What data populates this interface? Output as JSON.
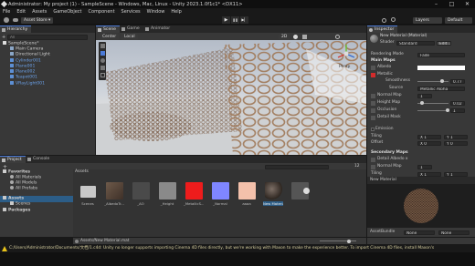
{
  "window": {
    "title": "Administrator: My project (1) - SampleScene - Windows, Mac, Linux - Unity 2023.1.0f1c1* <DX11>",
    "minimize": "–",
    "maximize": "□",
    "close": "✕"
  },
  "menu": [
    "File",
    "Edit",
    "Assets",
    "GameObject",
    "Component",
    "Services",
    "Window",
    "Help"
  ],
  "toolbar": {
    "account": "Asset Store ▾",
    "play": "▶",
    "pause": "❚❚",
    "step": "▶▏",
    "layers": "Layers",
    "layout": "Default"
  },
  "hierarchy": {
    "tab": "Hierarchy",
    "search_placeholder": "All",
    "scene": "SampleScene*",
    "items": [
      "Main Camera",
      "Directional Light",
      "Cylinder001",
      "Plane001",
      "Plane002",
      "Teapot001",
      "VRayLight001"
    ]
  },
  "scene": {
    "tabs": [
      "Scene",
      "Game",
      "Animator"
    ],
    "pivot": "Center",
    "space": "Local",
    "mode": "2D",
    "persp_label": "Persp"
  },
  "inspector": {
    "tab": "Inspector",
    "material_name": "New Material (Material)",
    "shader_label": "Shader",
    "shader_value": "Standard",
    "edit_label": "Edit...",
    "rendering_mode_label": "Rendering Mode",
    "rendering_mode_value": "Fade",
    "main_maps": "Main Maps",
    "albedo": "Albedo",
    "metallic": "Metallic",
    "smoothness": "Smoothness",
    "smoothness_value": "0.77",
    "source": "Source",
    "source_value": "Metallic Alpha",
    "normal_map": "Normal Map",
    "normal_value": "1",
    "height_map": "Height Map",
    "height_value": "0.02",
    "occlusion": "Occlusion",
    "occlusion_value": "1",
    "detail_mask": "Detail Mask",
    "emission": "Emission",
    "tiling": "Tiling",
    "offset": "Offset",
    "tiling_x": "X 1",
    "tiling_y": "Y 1",
    "offset_x": "X 0",
    "offset_y": "Y 0",
    "secondary_maps": "Secondary Maps",
    "detail_albedo": "Detail Albedo x",
    "sec_normal_map": "Normal Map",
    "sec_normal_value": "1",
    "sec_tiling": "Tiling",
    "sec_tiling_x": "X 1",
    "sec_tiling_y": "Y 1",
    "preview_title": "New Material",
    "assetbundle_label": "AssetBundle",
    "assetbundle_value": "None",
    "assetbundle_variant": "None"
  },
  "project": {
    "tabs": [
      "Project",
      "Console"
    ],
    "favorites": "Favorites",
    "fav_items": [
      "All Materials",
      "All Models",
      "All Prefabs"
    ],
    "assets": "Assets",
    "assets_items": [
      "Scenes"
    ],
    "packages": "Packages",
    "breadcrumb": "Assets",
    "footer_path": "Assets/New Material.mat",
    "item_count": "12",
    "thumbnails": [
      "Scenes",
      "_AlbedoTr...",
      "_AO",
      "_Height",
      "_MetallicS...",
      "_Normal",
      "aaaa",
      "New Material",
      ""
    ]
  },
  "statusbar": {
    "message": "C:/Users/Administrator/Documents/文档/1.c4d: Unity no longer supports importing Cinema 4D files directly, but we're working with Maxon to make the experience better. To import Cinema 4D files, install Maxon's"
  },
  "colors": {
    "accent": "#4b7bd8",
    "albedo_swatch": "#ffffff",
    "metallic_swatch": "#d32b2b",
    "selected_row": "#2c5d87",
    "warning": "#e8c21a"
  }
}
